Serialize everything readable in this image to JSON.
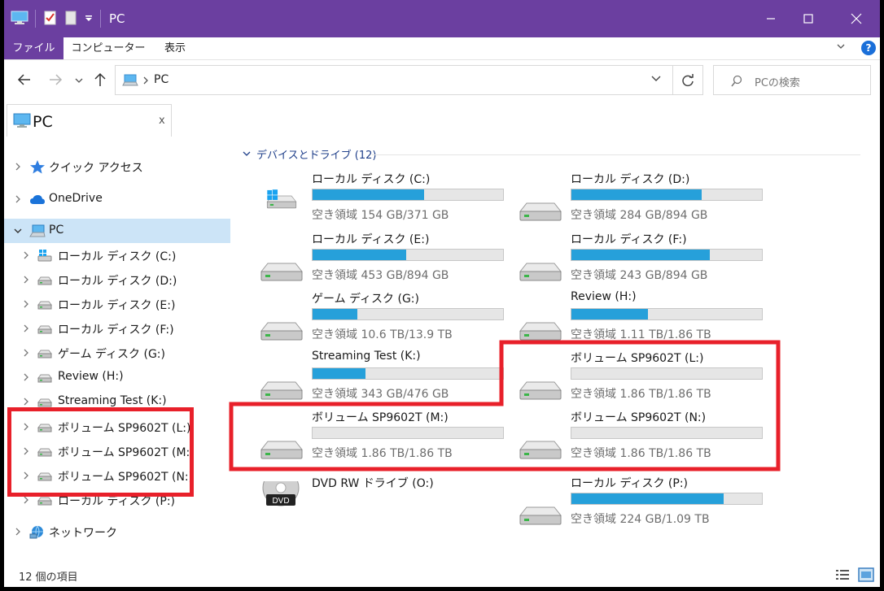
{
  "window": {
    "title": "PC"
  },
  "ribbon": {
    "tabs": [
      "ファイル",
      "コンピューター",
      "表示"
    ]
  },
  "address": {
    "path": "PC",
    "search_placeholder": "PCの検索"
  },
  "tab": {
    "label": "PC",
    "close": "x"
  },
  "nav": [
    {
      "label": "クイック アクセス",
      "icon": "star-icon"
    },
    {
      "label": "OneDrive",
      "icon": "cloud-icon"
    },
    {
      "label": "PC",
      "icon": "computer-icon",
      "expanded": true,
      "selected": true
    },
    {
      "label": "ローカル ディスク (C:)",
      "icon": "windows-drive-icon"
    },
    {
      "label": "ローカル ディスク (D:)",
      "icon": "drive-icon"
    },
    {
      "label": "ローカル ディスク (E:)",
      "icon": "drive-icon"
    },
    {
      "label": "ローカル ディスク (F:)",
      "icon": "drive-icon"
    },
    {
      "label": "ゲーム ディスク (G:)",
      "icon": "drive-icon"
    },
    {
      "label": "Review (H:)",
      "icon": "drive-icon"
    },
    {
      "label": "Streaming Test (K:)",
      "icon": "drive-icon"
    },
    {
      "label": "ボリューム SP9602T (L:)",
      "icon": "drive-icon"
    },
    {
      "label": "ボリューム SP9602T (M:)",
      "icon": "drive-icon"
    },
    {
      "label": "ボリューム SP9602T (N:)",
      "icon": "drive-icon"
    },
    {
      "label": "ローカル ディスク (P:)",
      "icon": "drive-icon"
    },
    {
      "label": "ネットワーク",
      "icon": "network-icon"
    }
  ],
  "group": {
    "label": "デバイスとドライブ (12)"
  },
  "drives": [
    {
      "name": "ローカル ディスク (C:)",
      "free": "空き領域 154 GB/371 GB",
      "used_fraction": 0.585,
      "icon": "windows-drive-icon"
    },
    {
      "name": "ローカル ディスク (D:)",
      "free": "空き領域 284 GB/894 GB",
      "used_fraction": 0.682,
      "icon": "drive-icon"
    },
    {
      "name": "ローカル ディスク (E:)",
      "free": "空き領域 453 GB/894 GB",
      "used_fraction": 0.493,
      "icon": "drive-icon"
    },
    {
      "name": "ローカル ディスク (F:)",
      "free": "空き領域 243 GB/894 GB",
      "used_fraction": 0.728,
      "icon": "drive-icon"
    },
    {
      "name": "ゲーム ディスク (G:)",
      "free": "空き領域 10.6 TB/13.9 TB",
      "used_fraction": 0.237,
      "icon": "drive-icon"
    },
    {
      "name": "Review (H:)",
      "free": "空き領域 1.11 TB/1.86 TB",
      "used_fraction": 0.403,
      "icon": "drive-icon"
    },
    {
      "name": "Streaming Test (K:)",
      "free": "空き領域 343 GB/476 GB",
      "used_fraction": 0.279,
      "icon": "drive-icon"
    },
    {
      "name": "ボリューム SP9602T (L:)",
      "free": "空き領域 1.86 TB/1.86 TB",
      "used_fraction": 0.0,
      "icon": "drive-icon"
    },
    {
      "name": "ボリューム SP9602T (M:)",
      "free": "空き領域 1.86 TB/1.86 TB",
      "used_fraction": 0.0,
      "icon": "drive-icon"
    },
    {
      "name": "ボリューム SP9602T (N:)",
      "free": "空き領域 1.86 TB/1.86 TB",
      "used_fraction": 0.0,
      "icon": "drive-icon"
    },
    {
      "name": "DVD RW ドライブ (O:)",
      "free": "",
      "used_fraction": null,
      "icon": "dvd-drive-icon",
      "dvd_label": "DVD"
    },
    {
      "name": "ローカル ディスク (P:)",
      "free": "空き領域 224 GB/1.09 TB",
      "used_fraction": 0.8,
      "icon": "drive-icon"
    }
  ],
  "status": {
    "text": "12 個の項目"
  },
  "colors": {
    "titlebar": "#6b3fa0",
    "bar_fill": "#26a0da",
    "selection": "#cce4f7",
    "highlight": "#e8202a"
  }
}
